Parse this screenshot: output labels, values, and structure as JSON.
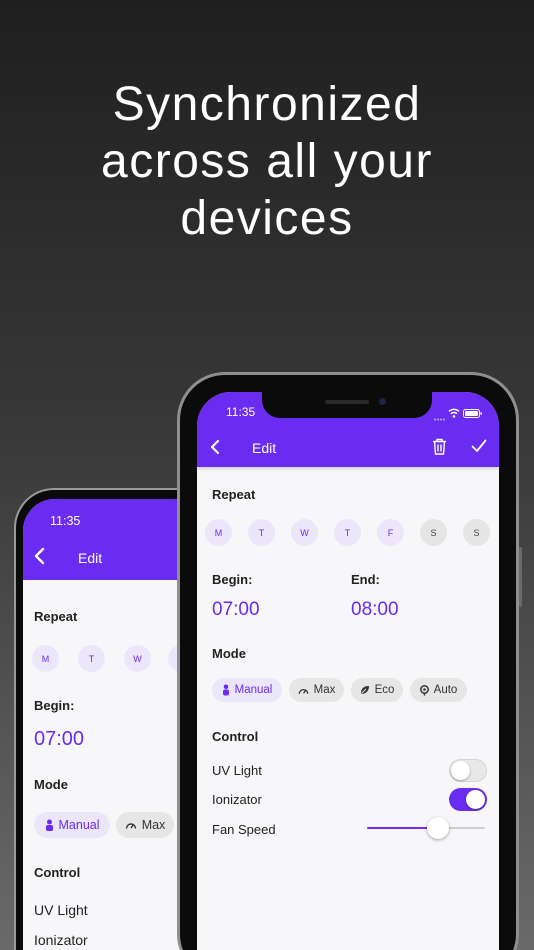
{
  "headline": [
    "Synchronized",
    "across all your",
    "devices"
  ],
  "colors": {
    "accent": "#6a2cf0",
    "accent_light": "#ece6fb"
  },
  "front_phone": {
    "time": "11:35",
    "title": "Edit",
    "repeat_label": "Repeat",
    "days": [
      "M",
      "T",
      "W",
      "T",
      "F",
      "S",
      "S"
    ],
    "begin_label": "Begin:",
    "begin_time": "07:00",
    "end_label": "End:",
    "end_time": "08:00",
    "mode_label": "Mode",
    "modes": [
      {
        "label": "Manual",
        "icon": "hand-icon",
        "active": true
      },
      {
        "label": "Max",
        "icon": "speedometer-icon",
        "active": false
      },
      {
        "label": "Eco",
        "icon": "leaf-icon",
        "active": false
      },
      {
        "label": "Auto",
        "icon": "auto-icon",
        "active": false
      }
    ],
    "control_label": "Control",
    "controls": [
      {
        "label": "UV Light",
        "on": false
      },
      {
        "label": "Ionizator",
        "on": true
      }
    ],
    "fan_label": "Fan Speed",
    "fan_level": 0.6
  },
  "back_phone": {
    "time": "11:35",
    "title": "Edit",
    "repeat_label": "Repeat",
    "days": [
      "M",
      "T",
      "W"
    ],
    "begin_label": "Begin:",
    "begin_time": "07:00",
    "mode_label": "Mode",
    "modes": [
      {
        "label": "Manual",
        "icon": "hand-icon",
        "active": true
      },
      {
        "label": "Max",
        "icon": "speedometer-icon",
        "active": false
      }
    ],
    "control_label": "Control",
    "controls": [
      "UV Light",
      "Ionizator"
    ]
  }
}
